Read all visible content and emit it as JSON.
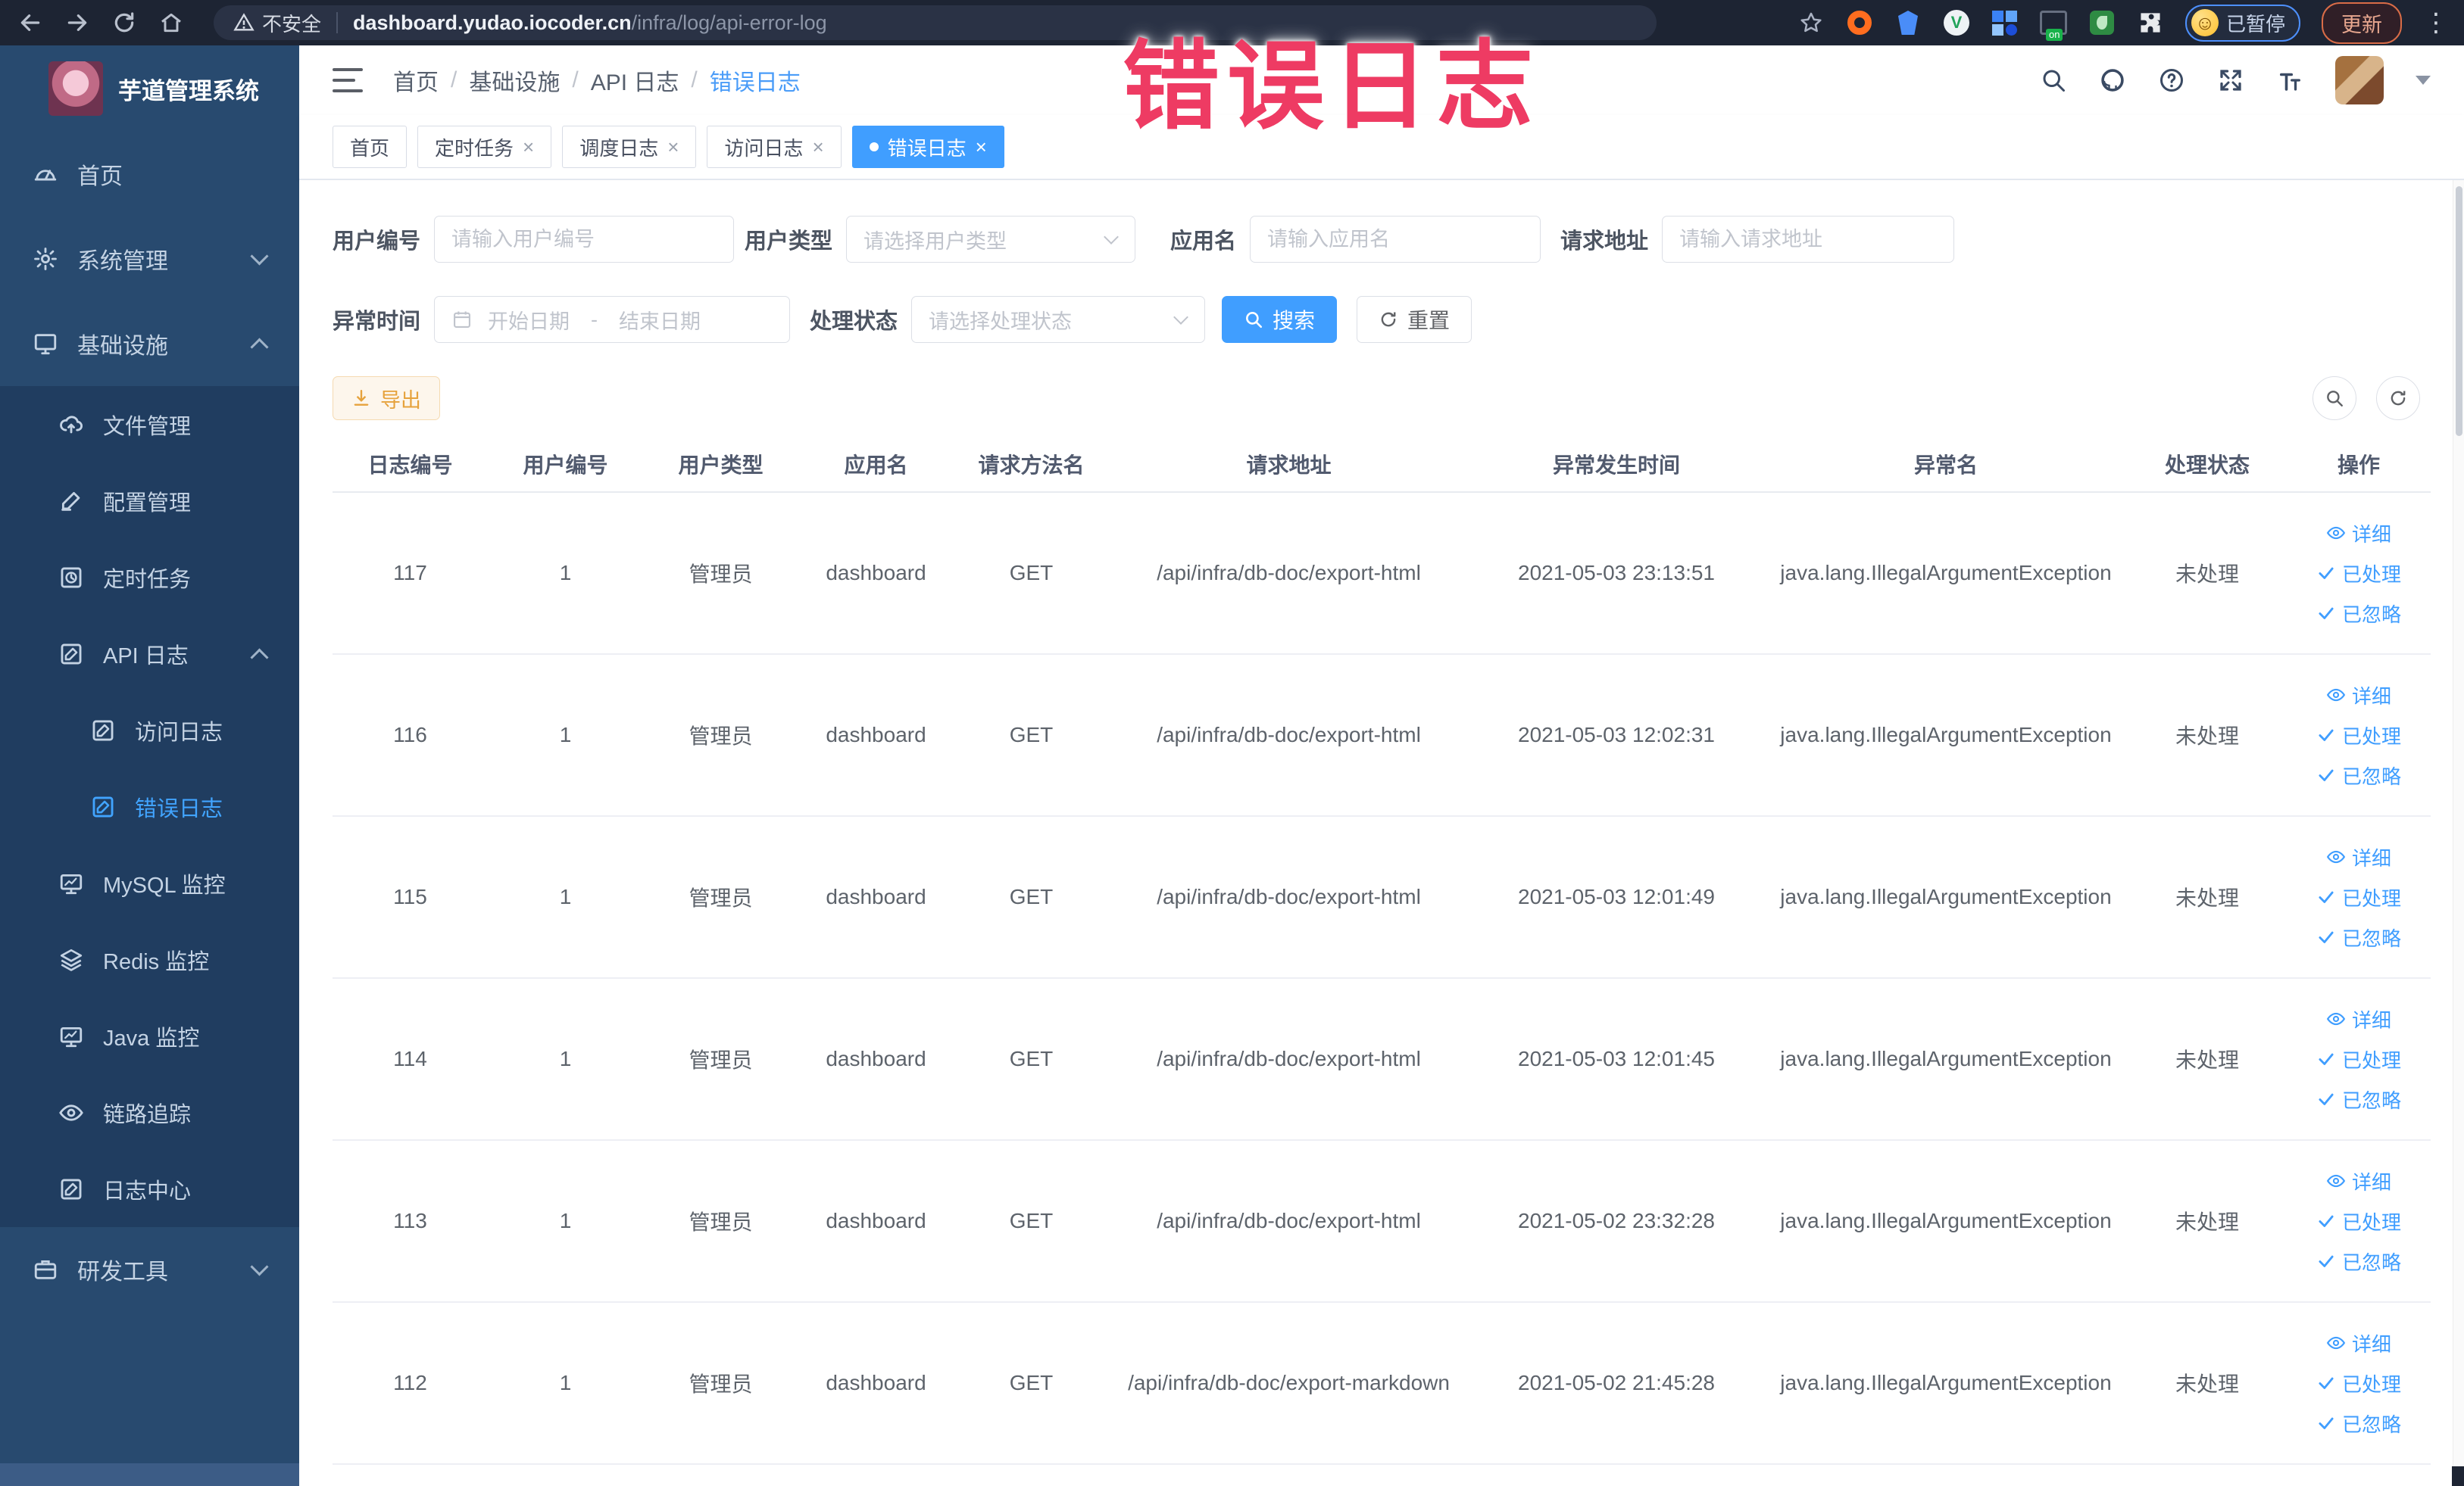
{
  "browser": {
    "security_label": "不安全",
    "url_domain": "dashboard.yudao.iocoder.cn",
    "url_path": "/infra/log/api-error-log",
    "paused_badge": "已暂停",
    "update_label": "更新"
  },
  "watermark": "错误日志",
  "sidebar": {
    "logo_title": "芋道管理系统",
    "items": [
      {
        "key": "home",
        "label": "首页",
        "icon": "gauge-icon",
        "level": 0,
        "section": "main"
      },
      {
        "key": "system-mgmt",
        "label": "系统管理",
        "icon": "gear-icon",
        "level": 0,
        "section": "main",
        "chevron": "down"
      },
      {
        "key": "infrastructure",
        "label": "基础设施",
        "icon": "monitor-icon",
        "level": 0,
        "section": "main",
        "chevron": "up"
      },
      {
        "key": "file-mgmt",
        "label": "文件管理",
        "icon": "cloud-upload-icon",
        "level": 1,
        "section": "sub"
      },
      {
        "key": "config-mgmt",
        "label": "配置管理",
        "icon": "edit-icon",
        "level": 1,
        "section": "sub"
      },
      {
        "key": "scheduled-tasks",
        "label": "定时任务",
        "icon": "timer-icon",
        "level": 1,
        "section": "sub"
      },
      {
        "key": "api-log",
        "label": "API 日志",
        "icon": "log-icon",
        "level": 1,
        "section": "sub",
        "chevron": "up"
      },
      {
        "key": "access-log",
        "label": "访问日志",
        "icon": "doc-edit-icon",
        "level": 2,
        "section": "sub"
      },
      {
        "key": "error-log",
        "label": "错误日志",
        "icon": "doc-edit-icon",
        "level": 2,
        "section": "sub",
        "active": true
      },
      {
        "key": "mysql-monitor",
        "label": "MySQL 监控",
        "icon": "screen-icon",
        "level": 1,
        "section": "sub"
      },
      {
        "key": "redis-monitor",
        "label": "Redis 监控",
        "icon": "layers-icon",
        "level": 1,
        "section": "sub"
      },
      {
        "key": "java-monitor",
        "label": "Java 监控",
        "icon": "screen-icon",
        "level": 1,
        "section": "sub"
      },
      {
        "key": "trace",
        "label": "链路追踪",
        "icon": "eye-icon",
        "level": 1,
        "section": "sub"
      },
      {
        "key": "log-center",
        "label": "日志中心",
        "icon": "doc-edit-icon",
        "level": 1,
        "section": "sub"
      },
      {
        "key": "dev-tools",
        "label": "研发工具",
        "icon": "briefcase-icon",
        "level": 0,
        "section": "tools",
        "chevron": "down"
      }
    ]
  },
  "header": {
    "breadcrumb": [
      "首页",
      "基础设施",
      "API 日志",
      "错误日志"
    ]
  },
  "tabs": [
    {
      "label": "首页",
      "closable": false,
      "active": false
    },
    {
      "label": "定时任务",
      "closable": true,
      "active": false
    },
    {
      "label": "调度日志",
      "closable": true,
      "active": false
    },
    {
      "label": "访问日志",
      "closable": true,
      "active": false
    },
    {
      "label": "错误日志",
      "closable": true,
      "active": true
    }
  ],
  "filters": {
    "user_id": {
      "label": "用户编号",
      "placeholder": "请输入用户编号"
    },
    "user_type": {
      "label": "用户类型",
      "placeholder": "请选择用户类型"
    },
    "app_name": {
      "label": "应用名",
      "placeholder": "请输入应用名"
    },
    "request_url": {
      "label": "请求地址",
      "placeholder": "请输入请求地址"
    },
    "exception_time": {
      "label": "异常时间",
      "start_placeholder": "开始日期",
      "separator": "-",
      "end_placeholder": "结束日期"
    },
    "process_status": {
      "label": "处理状态",
      "placeholder": "请选择处理状态"
    },
    "search_label": "搜索",
    "reset_label": "重置"
  },
  "toolbar": {
    "export_label": "导出"
  },
  "table": {
    "headers": [
      "日志编号",
      "用户编号",
      "用户类型",
      "应用名",
      "请求方法名",
      "请求地址",
      "异常发生时间",
      "异常名",
      "处理状态",
      "操作"
    ],
    "action_labels": {
      "detail": "详细",
      "processed": "已处理",
      "ignored": "已忽略"
    },
    "rows": [
      {
        "id": "117",
        "user_id": "1",
        "user_type": "管理员",
        "app": "dashboard",
        "method": "GET",
        "url": "/api/infra/db-doc/export-html",
        "time": "2021-05-03 23:13:51",
        "exception": "java.lang.IllegalArgumentException",
        "status": "未处理"
      },
      {
        "id": "116",
        "user_id": "1",
        "user_type": "管理员",
        "app": "dashboard",
        "method": "GET",
        "url": "/api/infra/db-doc/export-html",
        "time": "2021-05-03 12:02:31",
        "exception": "java.lang.IllegalArgumentException",
        "status": "未处理"
      },
      {
        "id": "115",
        "user_id": "1",
        "user_type": "管理员",
        "app": "dashboard",
        "method": "GET",
        "url": "/api/infra/db-doc/export-html",
        "time": "2021-05-03 12:01:49",
        "exception": "java.lang.IllegalArgumentException",
        "status": "未处理"
      },
      {
        "id": "114",
        "user_id": "1",
        "user_type": "管理员",
        "app": "dashboard",
        "method": "GET",
        "url": "/api/infra/db-doc/export-html",
        "time": "2021-05-03 12:01:45",
        "exception": "java.lang.IllegalArgumentException",
        "status": "未处理"
      },
      {
        "id": "113",
        "user_id": "1",
        "user_type": "管理员",
        "app": "dashboard",
        "method": "GET",
        "url": "/api/infra/db-doc/export-html",
        "time": "2021-05-02 23:32:28",
        "exception": "java.lang.IllegalArgumentException",
        "status": "未处理"
      },
      {
        "id": "112",
        "user_id": "1",
        "user_type": "管理员",
        "app": "dashboard",
        "method": "GET",
        "url": "/api/infra/db-doc/export-markdown",
        "time": "2021-05-02 21:45:28",
        "exception": "java.lang.IllegalArgumentException",
        "status": "未处理"
      }
    ]
  },
  "colors": {
    "accent": "#409eff",
    "warning_button": "#e6a23c",
    "watermark": "#ee3b63",
    "sidebar_bg": "#284a6f",
    "sidebar_sub_bg": "#203d60"
  }
}
